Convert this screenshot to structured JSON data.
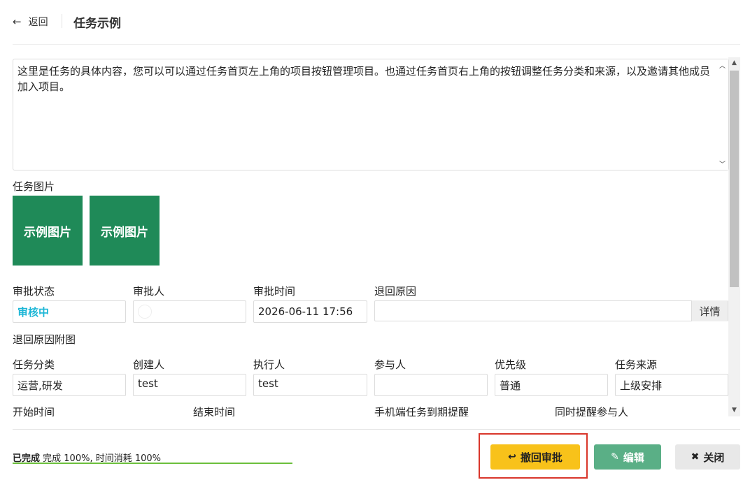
{
  "header": {
    "back_label": "返回",
    "title": "任务示例"
  },
  "content": {
    "text": "这里是任务的具体内容，您可以可以通过任务首页左上角的项目按钮管理项目。也通过任务首页右上角的按钮调整任务分类和来源，以及邀请其他成员加入项目。"
  },
  "images": {
    "label": "任务图片",
    "items": [
      "示例图片",
      "示例图片"
    ]
  },
  "approval": {
    "status_label": "审批状态",
    "status_value": "审核中",
    "approver_label": "审批人",
    "time_label": "审批时间",
    "time_value": "2026-06-11 17:56",
    "reason_label": "退回原因",
    "reason_value": "",
    "detail_button": "详情",
    "reason_attachment_label": "退回原因附图"
  },
  "task_info": {
    "category_label": "任务分类",
    "category_value": "运营,研发",
    "creator_label": "创建人",
    "creator_value": "test",
    "executor_label": "执行人",
    "executor_value": "test",
    "participant_label": "参与人",
    "participant_value": "",
    "priority_label": "优先级",
    "priority_value": "普通",
    "source_label": "任务来源",
    "source_value": "上级安排"
  },
  "schedule": {
    "start_label": "开始时间",
    "end_label": "结束时间",
    "mobile_reminder_label": "手机端任务到期提醒",
    "remind_participants_label": "同时提醒参与人"
  },
  "footer": {
    "status": "已完成",
    "progress_text": "完成 100%, 时间消耗 100%",
    "progress": 1.0,
    "revoke_button": "撤回审批",
    "edit_button": "编辑",
    "close_button": "关闭"
  },
  "colors": {
    "image_tile": "#1f8a58",
    "status_text": "#1cb6d6",
    "revoke_button": "#f8c21a",
    "edit_button": "#5aaf86",
    "close_button": "#e8e8e8",
    "highlight_border": "#d9362b",
    "progress_fill": "#6cbf3c"
  },
  "icons": {
    "back": "arrow-left-icon",
    "revoke": "undo-arrow-icon",
    "edit": "edit-icon",
    "close": "close-x-icon"
  }
}
